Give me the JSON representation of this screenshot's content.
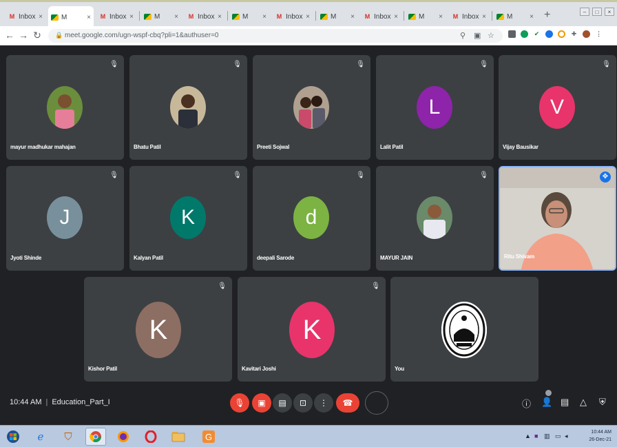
{
  "browser": {
    "tabs": [
      {
        "icon": "gmail",
        "label": "Inbox"
      },
      {
        "icon": "meet",
        "label": "M"
      },
      {
        "icon": "gmail",
        "label": "Inbox"
      },
      {
        "icon": "meet",
        "label": "M"
      },
      {
        "icon": "gmail",
        "label": "Inbox"
      },
      {
        "icon": "meet",
        "label": "M"
      },
      {
        "icon": "gmail",
        "label": "Inbox"
      },
      {
        "icon": "meet",
        "label": "M"
      },
      {
        "icon": "gmail",
        "label": "Inbox"
      },
      {
        "icon": "meet",
        "label": "M"
      },
      {
        "icon": "gmail",
        "label": "Inbox"
      },
      {
        "icon": "meet",
        "label": "M"
      }
    ],
    "new_tab": "+",
    "address": "meet.google.com/ugn-wspf-cbq?pli=1&authuser=0"
  },
  "participants": [
    {
      "name": "mayur madhukar mahajan",
      "type": "photo",
      "color": "#5a7a3a"
    },
    {
      "name": "Bhatu Patil",
      "type": "photo",
      "color": "#6a6f78"
    },
    {
      "name": "Preeti Sojwal",
      "type": "photo",
      "color": "#a05a5a"
    },
    {
      "name": "Lalit Patil",
      "type": "initial",
      "initial": "L",
      "color": "#8e24aa"
    },
    {
      "name": "Vijay Bausikar",
      "type": "initial",
      "initial": "V",
      "color": "#e8346b"
    },
    {
      "name": "Jyoti Shinde",
      "type": "initial",
      "initial": "J",
      "color": "#78909c"
    },
    {
      "name": "Kalyan Patil",
      "type": "initial",
      "initial": "K",
      "color": "#00796b"
    },
    {
      "name": "deepali Sarode",
      "type": "initial",
      "initial": "d",
      "color": "#7cb342"
    },
    {
      "name": "MAYUR JAIN",
      "type": "photo",
      "color": "#4d6b4d"
    },
    {
      "name": "Ritu Shivam",
      "type": "video",
      "color": "#e8a08a"
    },
    {
      "name": "Kishor Patil",
      "type": "initial",
      "initial": "K",
      "color": "#8d6e63"
    },
    {
      "name": "Kavitari Joshi",
      "type": "initial",
      "initial": "K",
      "color": "#e8346b"
    },
    {
      "name": "You",
      "type": "logo",
      "color": "#ffffff"
    }
  ],
  "meeting": {
    "time": "10:44 AM",
    "separator": "|",
    "code": "Education_Part_I"
  },
  "taskbar": {
    "clock_time": "10:44 AM",
    "clock_date": "26-Dec-21"
  }
}
